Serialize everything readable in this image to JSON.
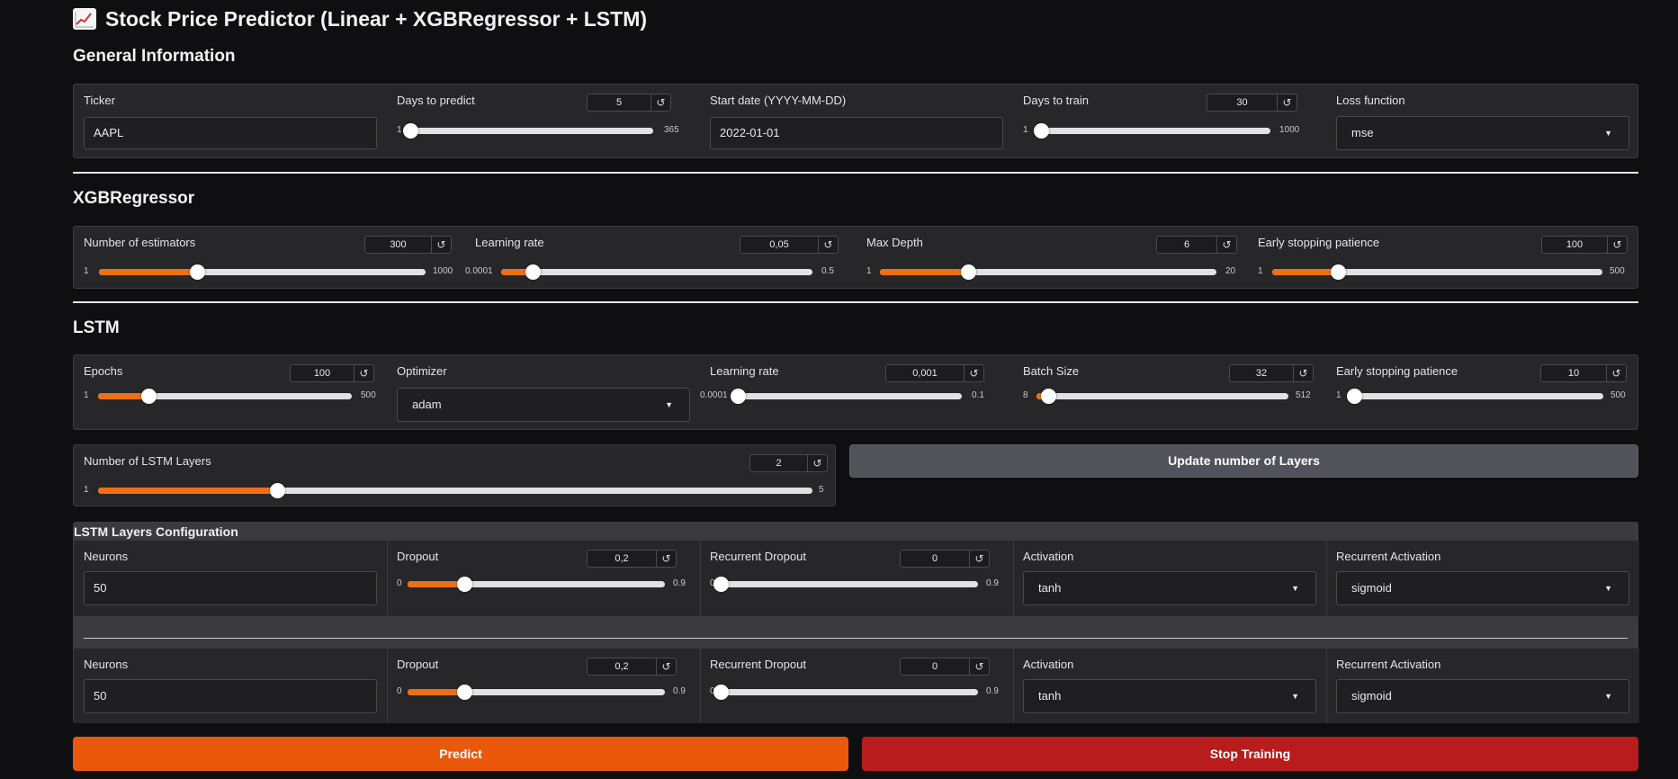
{
  "app": {
    "title": "Stock Price Predictor (Linear + XGBRegressor + LSTM)",
    "title_icon": "chart-increasing-icon"
  },
  "general": {
    "heading": "General Information",
    "ticker": {
      "label": "Ticker",
      "value": "AAPL"
    },
    "days_to_predict": {
      "label": "Days to predict",
      "value": "5",
      "min": "1",
      "max": "365",
      "fraction": 0.011
    },
    "start_date": {
      "label": "Start date (YYYY-MM-DD)",
      "value": "2022-01-01"
    },
    "days_to_train": {
      "label": "Days to train",
      "value": "30",
      "min": "1",
      "max": "1000",
      "fraction": 0.029
    },
    "loss_function": {
      "label": "Loss function",
      "value": "mse"
    }
  },
  "xgb": {
    "heading": "XGBRegressor",
    "n_estimators": {
      "label": "Number of estimators",
      "value": "300",
      "min": "1",
      "max": "1000",
      "fraction": 0.3
    },
    "learning_rate": {
      "label": "Learning rate",
      "value": "0,05",
      "min": "0.0001",
      "max": "0.5",
      "fraction": 0.1
    },
    "max_depth": {
      "label": "Max Depth",
      "value": "6",
      "min": "1",
      "max": "20",
      "fraction": 0.263
    },
    "early_stopping": {
      "label": "Early stopping patience",
      "value": "100",
      "min": "1",
      "max": "500",
      "fraction": 0.198
    }
  },
  "lstm": {
    "heading": "LSTM",
    "epochs": {
      "label": "Epochs",
      "value": "100",
      "min": "1",
      "max": "500",
      "fraction": 0.198
    },
    "optimizer": {
      "label": "Optimizer",
      "value": "adam"
    },
    "learning_rate": {
      "label": "Learning rate",
      "value": "0,001",
      "min": "0.0001",
      "max": "0.1",
      "fraction": 0.009
    },
    "batch_size": {
      "label": "Batch Size",
      "value": "32",
      "min": "8",
      "max": "512",
      "fraction": 0.048
    },
    "early_stopping": {
      "label": "Early stopping patience",
      "value": "10",
      "min": "1",
      "max": "500",
      "fraction": 0.018
    },
    "num_layers": {
      "label": "Number of LSTM Layers",
      "value": "2",
      "min": "1",
      "max": "5",
      "fraction": 0.25
    },
    "update_button": "Update number of Layers"
  },
  "layers_config": {
    "heading": "LSTM Layers Configuration",
    "layers": [
      {
        "neurons_label": "Neurons",
        "neurons": "50",
        "dropout": {
          "label": "Dropout",
          "value": "0,2",
          "min": "0",
          "max": "0.9",
          "fraction": 0.222
        },
        "rec_dropout": {
          "label": "Recurrent Dropout",
          "value": "0",
          "min": "0",
          "max": "0.9",
          "fraction": 0.0
        },
        "activation_label": "Activation",
        "activation": "tanh",
        "rec_activation_label": "Recurrent Activation",
        "rec_activation": "sigmoid"
      },
      {
        "neurons_label": "Neurons",
        "neurons": "50",
        "dropout": {
          "label": "Dropout",
          "value": "0,2",
          "min": "0",
          "max": "0.9",
          "fraction": 0.222
        },
        "rec_dropout": {
          "label": "Recurrent Dropout",
          "value": "0",
          "min": "0",
          "max": "0.9",
          "fraction": 0.0
        },
        "activation_label": "Activation",
        "activation": "tanh",
        "rec_activation_label": "Recurrent Activation",
        "rec_activation": "sigmoid"
      }
    ]
  },
  "actions": {
    "predict": "Predict",
    "stop": "Stop Training"
  },
  "colors": {
    "accent": "#f06f14",
    "predict": "#ea580c",
    "stop": "#b91c1c",
    "background": "#0f0f11",
    "panel": "#27272a"
  },
  "icons": {
    "reset": "reset-icon",
    "dropdown": "chevron-down-icon"
  }
}
